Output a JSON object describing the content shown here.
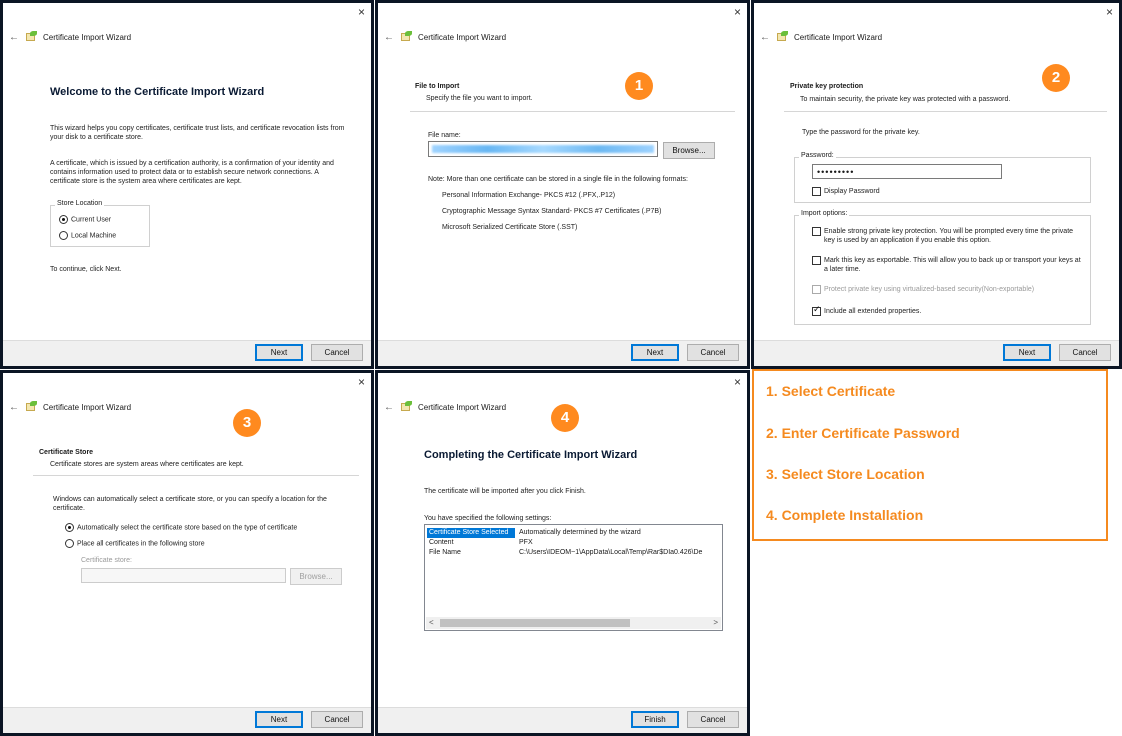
{
  "common": {
    "wizard_title": "Certificate Import Wizard",
    "close_glyph": "×",
    "back_glyph": "←",
    "next_label": "Next",
    "cancel_label": "Cancel",
    "finish_label": "Finish"
  },
  "panel1": {
    "heading": "Welcome to the Certificate Import Wizard",
    "para1": "This wizard helps you copy certificates, certificate trust lists, and certificate revocation lists from your disk to a certificate store.",
    "para2": "A certificate, which is issued by a certification authority, is a confirmation of your identity and contains information used to protect data or to establish secure network connections. A certificate store is the system area where certificates are kept.",
    "store_location_label": "Store Location",
    "options": [
      "Current User",
      "Local Machine"
    ],
    "selected_option": "Current User",
    "continue_text": "To continue, click Next."
  },
  "panel2": {
    "badge": "1",
    "heading": "File to Import",
    "subheading": "Specify the file you want to import.",
    "file_name_label": "File name:",
    "browse_label": "Browse...",
    "note": "Note:  More than one certificate can be stored in a single file in the following formats:",
    "formats": [
      "Personal Information Exchange- PKCS #12 (.PFX,.P12)",
      "Cryptographic Message Syntax Standard- PKCS #7 Certificates (.P7B)",
      "Microsoft Serialized Certificate Store (.SST)"
    ]
  },
  "panel3": {
    "badge": "2",
    "heading": "Private key protection",
    "subheading": "To maintain security, the private key was protected with a password.",
    "type_password": "Type the password for the private key.",
    "password_label": "Password:",
    "password_value": "•••••••••",
    "display_password": "Display Password",
    "import_options_label": "Import options:",
    "opt_strong": "Enable strong private key protection. You will be prompted every time the private key is used by an application if you enable this option.",
    "opt_exportable": "Mark this key as exportable. This will allow you to back up or transport your keys at a later time.",
    "opt_vbs": "Protect private key using virtualized-based security(Non-exportable)",
    "opt_extended": "Include all extended properties."
  },
  "panel4": {
    "badge": "3",
    "heading": "Certificate Store",
    "subheading": "Certificate stores are system areas where certificates are kept.",
    "intro": "Windows can automatically select a certificate store, or you can specify a location for the certificate.",
    "opt_auto": "Automatically select the certificate store based on the type of certificate",
    "opt_place": "Place all certificates in the following store",
    "store_label": "Certificate store:",
    "browse_label": "Browse..."
  },
  "panel5": {
    "badge": "4",
    "heading": "Completing the Certificate Import Wizard",
    "intro": "The certificate will be imported after you click Finish.",
    "settings_label": "You have specified the following settings:",
    "settings": [
      {
        "key": "Certificate Store Selected",
        "value": "Automatically determined by the wizard"
      },
      {
        "key": "Content",
        "value": "PFX"
      },
      {
        "key": "File Name",
        "value": "C:\\Users\\IDEOM~1\\AppData\\Local\\Temp\\Rar$DIa0.426\\De"
      }
    ],
    "scroll_left": "<",
    "scroll_right": ">"
  },
  "steps": [
    "1. Select Certificate",
    "2. Enter Certificate Password",
    "3. Select Store Location",
    "4. Complete Installation"
  ],
  "colors": {
    "accent_orange": "#f58a1f",
    "badge_orange": "#ff8a1f",
    "selection_blue": "#0078d7",
    "panel_border": "#0b1524"
  }
}
